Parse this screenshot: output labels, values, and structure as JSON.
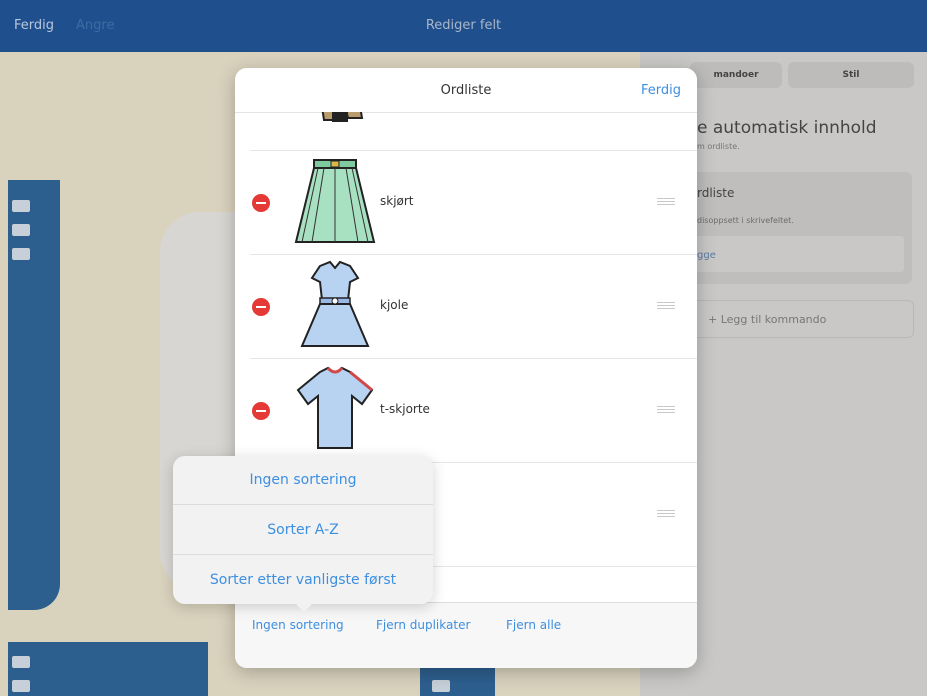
{
  "topbar": {
    "done_label": "Ferdig",
    "prev_label": "Angre",
    "title": "Rediger felt"
  },
  "right_panel": {
    "segments": [
      "mandoer",
      "Stil"
    ],
    "heading": "e automatisk innhold",
    "subtext": "m ordliste.",
    "box_title": "rdliste",
    "box_subtext": "disoppsett i skrivefeltet.",
    "box_link": "gge",
    "add_command_label": "Legg til kommando"
  },
  "modal": {
    "title": "Ordliste",
    "done_label": "Ferdig",
    "items": [
      {
        "label": "skjørt",
        "icon": "skirt-icon"
      },
      {
        "label": "kjole",
        "icon": "dress-icon"
      },
      {
        "label": "t-skjorte",
        "icon": "tshirt-icon"
      },
      {
        "label": "",
        "icon": ""
      }
    ],
    "toolbar": {
      "sort_label": "Ingen sortering",
      "remove_duplicates_label": "Fjern duplikater",
      "remove_all_label": "Fjern alle"
    }
  },
  "popover": {
    "options": [
      "Ingen sortering",
      "Sorter A-Z",
      "Sorter etter vanligste først"
    ]
  },
  "colors": {
    "accent": "#3d8fe0",
    "delete": "#e53935",
    "topbar": "#1f4f8d"
  }
}
